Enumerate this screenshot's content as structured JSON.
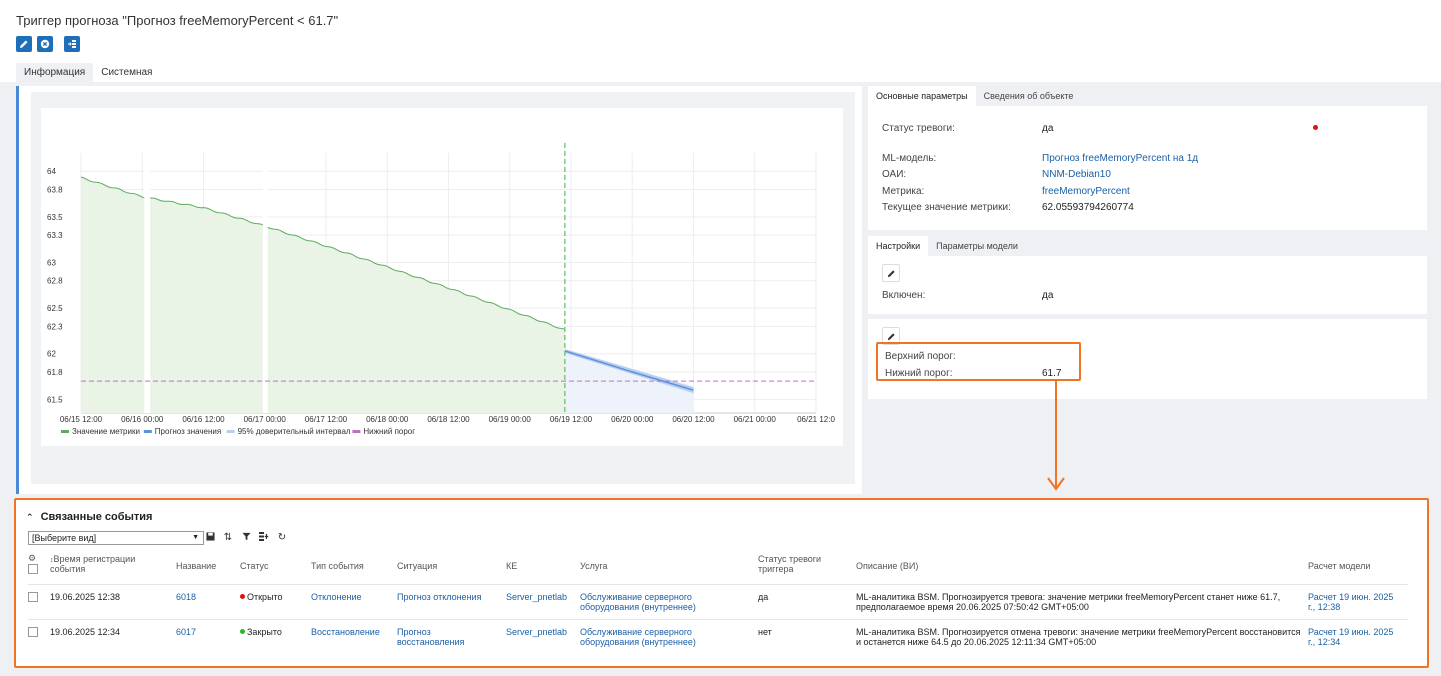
{
  "header": {
    "title": "Триггер прогноза \"Прогноз freeMemoryPercent < 61.7\"",
    "tabs": [
      "Информация",
      "Системная"
    ]
  },
  "chart_data": {
    "type": "line",
    "x_ticks": [
      "06/15 12:00",
      "06/16 00:00",
      "06/16 12:00",
      "06/17 00:00",
      "06/17 12:00",
      "06/18 00:00",
      "06/18 12:00",
      "06/19 00:00",
      "06/19 12:00",
      "06/20 00:00",
      "06/20 12:00",
      "06/21 00:00",
      "06/21 12:0"
    ],
    "y_ticks": [
      "64",
      "63.8",
      "63.5",
      "63.3",
      "63",
      "62.8",
      "62.5",
      "62.3",
      "62",
      "61.8",
      "61.5"
    ],
    "ylim": [
      61.35,
      64.2
    ],
    "series": [
      {
        "name": "Значение метрики",
        "color": "#5cad5c",
        "x": [
          0,
          0.5,
          1.0,
          1.5,
          2.0,
          2.5,
          3.0,
          3.5,
          3.95
        ],
        "y": [
          63.93,
          63.72,
          63.6,
          63.4,
          63.18,
          62.95,
          62.72,
          62.48,
          62.26
        ]
      },
      {
        "name": "Прогноз значения",
        "color": "#5b8fe0",
        "x": [
          3.95,
          4.5,
          5.0
        ],
        "y": [
          62.03,
          61.8,
          61.6
        ]
      },
      {
        "name": "95% доверительный интервал",
        "color": "#b8cff0"
      },
      {
        "name": "Нижний порог",
        "color": "#c070c0",
        "value": 61.7
      }
    ]
  },
  "main_params": {
    "tabs": [
      "Основные параметры",
      "Сведения об объекте"
    ],
    "alarm_status_label": "Статус тревоги:",
    "alarm_status_value": "да",
    "ml_model_label": "ML-модель:",
    "ml_model_value": "Прогноз freeMemoryPercent на 1д",
    "oai_label": "ОАИ:",
    "oai_value": "NNM-Debian10",
    "metric_label": "Метрика:",
    "metric_value": "freeMemoryPercent",
    "current_label": "Текущее значение метрики:",
    "current_value": "62.05593794260774"
  },
  "settings": {
    "tabs": [
      "Настройки",
      "Параметры модели"
    ],
    "enabled_label": "Включен:",
    "enabled_value": "да",
    "upper_label": "Верхний порог:",
    "lower_label": "Нижний порог:",
    "lower_value": "61.7"
  },
  "events": {
    "title": "Связанные события",
    "view_select": "[Выберите вид]",
    "columns": [
      "Время регистрации события",
      "Название",
      "Статус",
      "Тип события",
      "Ситуация",
      "КЕ",
      "Услуга",
      "Статус тревоги триггера",
      "Описание (ВИ)",
      "Расчет модели"
    ],
    "rows": [
      {
        "time": "19.06.2025 12:38",
        "name": "6018",
        "status": "Открыто",
        "status_color": "#e01010",
        "type": "Отклонение",
        "situation": "Прогноз отклонения",
        "ke": "Server_pnetlab",
        "service": "Обслуживание серверного оборудования (внутреннее)",
        "alarm": "да",
        "description": "ML-аналитика BSM. Прогнозируется тревога: значение метрики freeMemoryPercent станет ниже 61.7, предполагаемое время 20.06.2025 07:50:42 GMT+05:00",
        "calc": "Расчет 19 июн. 2025 г., 12:38"
      },
      {
        "time": "19.06.2025 12:34",
        "name": "6017",
        "status": "Закрыто",
        "status_color": "#2bb52b",
        "type": "Восстановление",
        "situation": "Прогноз восстановления",
        "ke": "Server_pnetlab",
        "service": "Обслуживание серверного оборудования (внутреннее)",
        "alarm": "нет",
        "description": "ML-аналитика BSM. Прогнозируется отмена тревоги: значение метрики freeMemoryPercent восстановится и останется ниже 64.5 до 20.06.2025 12:11:34 GMT+05:00",
        "calc": "Расчет 19 июн. 2025 г., 12:34"
      }
    ]
  },
  "colors": {
    "accent": "#1c6fb8",
    "highlight": "#f07422"
  }
}
